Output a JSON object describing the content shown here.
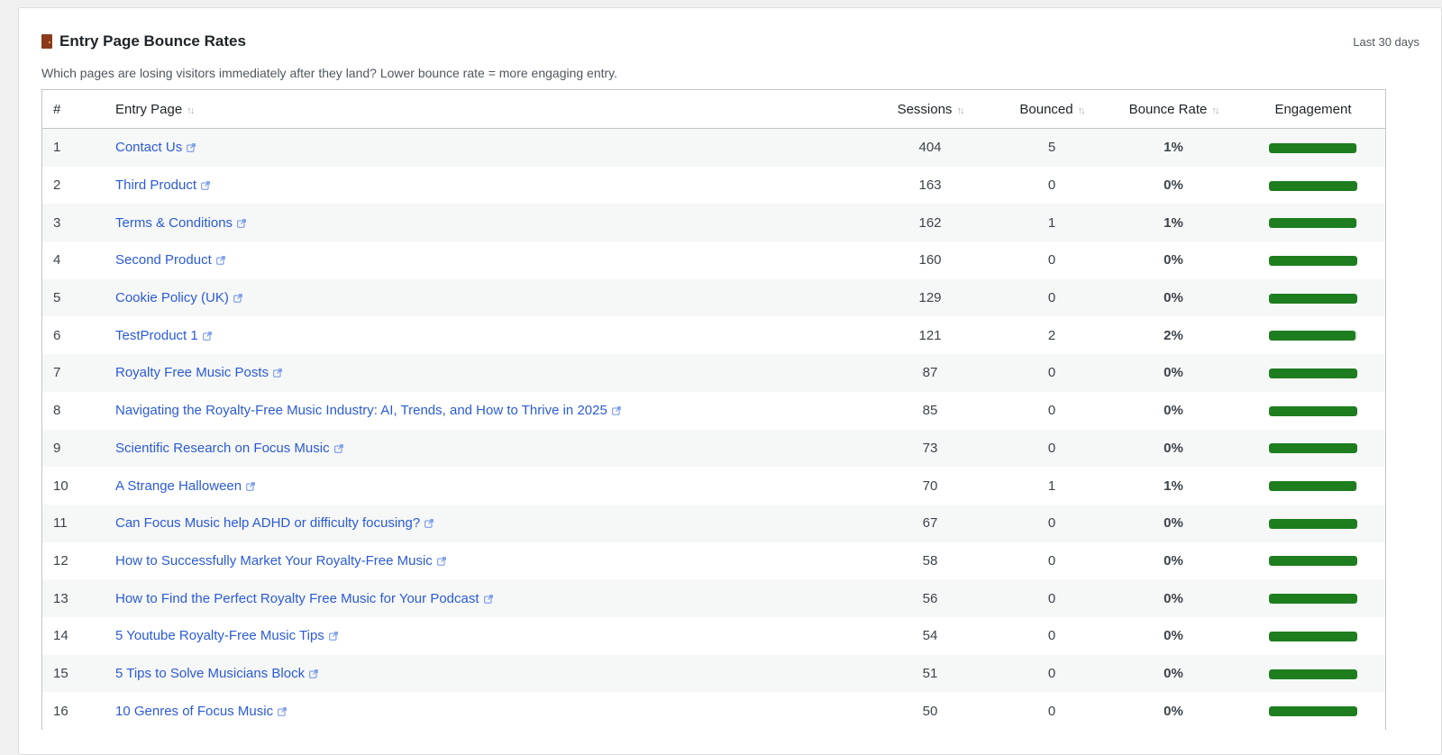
{
  "header": {
    "title": "Entry Page Bounce Rates",
    "icon": "door-icon",
    "range": "Last 30 days",
    "subtitle": "Which pages are losing visitors immediately after they land? Lower bounce rate = more engaging entry."
  },
  "table": {
    "columns": {
      "num": "#",
      "page": "Entry Page",
      "sessions": "Sessions",
      "bounced": "Bounced",
      "rate": "Bounce Rate",
      "engagement": "Engagement"
    },
    "rows": [
      {
        "num": "1",
        "page": "Contact Us",
        "sessions": "404",
        "bounced": "5",
        "rate": "1%",
        "engagement": 99
      },
      {
        "num": "2",
        "page": "Third Product",
        "sessions": "163",
        "bounced": "0",
        "rate": "0%",
        "engagement": 100
      },
      {
        "num": "3",
        "page": "Terms & Conditions",
        "sessions": "162",
        "bounced": "1",
        "rate": "1%",
        "engagement": 99
      },
      {
        "num": "4",
        "page": "Second Product",
        "sessions": "160",
        "bounced": "0",
        "rate": "0%",
        "engagement": 100
      },
      {
        "num": "5",
        "page": "Cookie Policy (UK)",
        "sessions": "129",
        "bounced": "0",
        "rate": "0%",
        "engagement": 100
      },
      {
        "num": "6",
        "page": "TestProduct 1",
        "sessions": "121",
        "bounced": "2",
        "rate": "2%",
        "engagement": 98
      },
      {
        "num": "7",
        "page": "Royalty Free Music Posts",
        "sessions": "87",
        "bounced": "0",
        "rate": "0%",
        "engagement": 100
      },
      {
        "num": "8",
        "page": "Navigating the Royalty-Free Music Industry: AI, Trends, and How to Thrive in 2025",
        "sessions": "85",
        "bounced": "0",
        "rate": "0%",
        "engagement": 100
      },
      {
        "num": "9",
        "page": "Scientific Research on Focus Music",
        "sessions": "73",
        "bounced": "0",
        "rate": "0%",
        "engagement": 100
      },
      {
        "num": "10",
        "page": "A Strange Halloween",
        "sessions": "70",
        "bounced": "1",
        "rate": "1%",
        "engagement": 99
      },
      {
        "num": "11",
        "page": "Can Focus Music help ADHD or difficulty focusing?",
        "sessions": "67",
        "bounced": "0",
        "rate": "0%",
        "engagement": 100
      },
      {
        "num": "12",
        "page": "How to Successfully Market Your Royalty-Free Music",
        "sessions": "58",
        "bounced": "0",
        "rate": "0%",
        "engagement": 100
      },
      {
        "num": "13",
        "page": "How to Find the Perfect Royalty Free Music for Your Podcast",
        "sessions": "56",
        "bounced": "0",
        "rate": "0%",
        "engagement": 100
      },
      {
        "num": "14",
        "page": "5 Youtube Royalty-Free Music Tips",
        "sessions": "54",
        "bounced": "0",
        "rate": "0%",
        "engagement": 100
      },
      {
        "num": "15",
        "page": "5 Tips to Solve Musicians Block",
        "sessions": "51",
        "bounced": "0",
        "rate": "0%",
        "engagement": 100
      },
      {
        "num": "16",
        "page": "10 Genres of Focus Music",
        "sessions": "50",
        "bounced": "0",
        "rate": "0%",
        "engagement": 100
      }
    ]
  },
  "colors": {
    "link": "#2a5bd7",
    "engagement_bar": "#1e7d1e",
    "row_stripe": "#f6f7f7"
  }
}
